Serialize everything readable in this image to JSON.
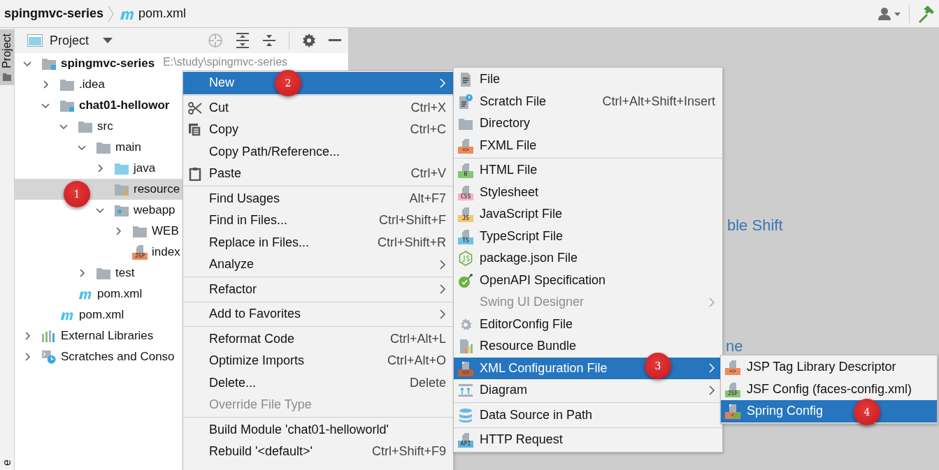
{
  "breadcrumb": {
    "project": "spingmvc-series",
    "file": "pom.xml"
  },
  "side_tabs": [
    {
      "label": "Project",
      "selected": true
    },
    {
      "label": "e",
      "selected": false
    }
  ],
  "project_panel": {
    "title": "Project"
  },
  "tree": [
    {
      "kind": "module",
      "label": "spingmvc-series",
      "path": "E:\\study\\spingmvc-series",
      "expanded": true,
      "selected": false,
      "children": [
        {
          "kind": "folder",
          "label": ".idea",
          "expanded": false,
          "selected": false
        },
        {
          "kind": "module",
          "label": "chat01-hellowor",
          "expanded": true,
          "selected": false,
          "children": [
            {
              "kind": "folder",
              "label": "src",
              "expanded": true,
              "selected": false,
              "children": [
                {
                  "kind": "folder",
                  "label": "main",
                  "expanded": true,
                  "selected": false,
                  "children": [
                    {
                      "kind": "source-folder",
                      "label": "java",
                      "expanded": false,
                      "selected": false
                    },
                    {
                      "kind": "resource-folder",
                      "label": "resource",
                      "selected": true
                    },
                    {
                      "kind": "web-folder",
                      "label": "webapp",
                      "expanded": true,
                      "selected": false,
                      "children": [
                        {
                          "kind": "folder",
                          "label": "WEB",
                          "expanded": false,
                          "selected": false
                        },
                        {
                          "kind": "jsp-file",
                          "badge": "JSP",
                          "label": "index",
                          "selected": false
                        }
                      ]
                    }
                  ]
                },
                {
                  "kind": "folder",
                  "label": "test",
                  "expanded": false,
                  "selected": false
                }
              ]
            },
            {
              "kind": "maven-file",
              "label": "pom.xml",
              "selected": false
            }
          ]
        },
        {
          "kind": "maven-file",
          "label": "pom.xml",
          "selected": false
        }
      ]
    },
    {
      "kind": "libraries",
      "label": "External Libraries",
      "expanded": false,
      "selected": false
    },
    {
      "kind": "scratches",
      "label": "Scratches and Conso",
      "expanded": false,
      "selected": false
    }
  ],
  "editor_hints": [
    "ble Shift",
    "ne"
  ],
  "context_menu": [
    {
      "kind": "none",
      "label": "New",
      "has_submenu": true,
      "selected": true,
      "disabled": false
    },
    {
      "kind": "separator"
    },
    {
      "kind": "cut",
      "label": "Cut",
      "shortcut": "Ctrl+X",
      "has_submenu": false,
      "selected": false,
      "disabled": false
    },
    {
      "kind": "copy",
      "label": "Copy",
      "shortcut": "Ctrl+C",
      "has_submenu": false,
      "selected": false,
      "disabled": false
    },
    {
      "kind": "none",
      "label": "Copy Path/Reference...",
      "has_submenu": false,
      "selected": false,
      "disabled": false
    },
    {
      "kind": "paste",
      "label": "Paste",
      "shortcut": "Ctrl+V",
      "has_submenu": false,
      "selected": false,
      "disabled": false
    },
    {
      "kind": "separator"
    },
    {
      "kind": "none",
      "label": "Find Usages",
      "shortcut": "Alt+F7",
      "has_submenu": false,
      "selected": false,
      "disabled": false
    },
    {
      "kind": "none",
      "label": "Find in Files...",
      "shortcut": "Ctrl+Shift+F",
      "has_submenu": false,
      "selected": false,
      "disabled": false
    },
    {
      "kind": "none",
      "label": "Replace in Files...",
      "shortcut": "Ctrl+Shift+R",
      "has_submenu": false,
      "selected": false,
      "disabled": false
    },
    {
      "kind": "none",
      "label": "Analyze",
      "has_submenu": true,
      "selected": false,
      "disabled": false
    },
    {
      "kind": "separator"
    },
    {
      "kind": "none",
      "label": "Refactor",
      "has_submenu": true,
      "selected": false,
      "disabled": false
    },
    {
      "kind": "separator"
    },
    {
      "kind": "none",
      "label": "Add to Favorites",
      "has_submenu": true,
      "selected": false,
      "disabled": false
    },
    {
      "kind": "separator"
    },
    {
      "kind": "none",
      "label": "Reformat Code",
      "shortcut": "Ctrl+Alt+L",
      "has_submenu": false,
      "selected": false,
      "disabled": false
    },
    {
      "kind": "none",
      "label": "Optimize Imports",
      "shortcut": "Ctrl+Alt+O",
      "has_submenu": false,
      "selected": false,
      "disabled": false
    },
    {
      "kind": "none",
      "label": "Delete...",
      "shortcut": "Delete",
      "has_submenu": false,
      "selected": false,
      "disabled": false
    },
    {
      "kind": "none",
      "label": "Override File Type",
      "has_submenu": false,
      "selected": false,
      "disabled": true
    },
    {
      "kind": "separator"
    },
    {
      "kind": "none",
      "label": "Build Module 'chat01-helloworld'",
      "has_submenu": false,
      "selected": false,
      "disabled": false
    },
    {
      "kind": "none",
      "label": "Rebuild '<default>'",
      "shortcut": "Ctrl+Shift+F9",
      "has_submenu": false,
      "selected": false,
      "disabled": false
    }
  ],
  "new_submenu": [
    {
      "kind": "file",
      "label": "File",
      "has_submenu": false,
      "selected": false,
      "disabled": false
    },
    {
      "kind": "scratch",
      "label": "Scratch File",
      "shortcut": "Ctrl+Alt+Shift+Insert",
      "has_submenu": false,
      "selected": false,
      "disabled": false
    },
    {
      "kind": "folder",
      "label": "Directory",
      "has_submenu": false,
      "selected": false,
      "disabled": false
    },
    {
      "kind": "badge-file",
      "badge": "<>",
      "color": "#ef8a5b",
      "label": "FXML File",
      "has_submenu": false,
      "selected": false,
      "disabled": false
    },
    {
      "kind": "separator"
    },
    {
      "kind": "badge-file",
      "badge": "H",
      "color": "#86c46f",
      "label": "HTML File",
      "has_submenu": false,
      "selected": false,
      "disabled": false
    },
    {
      "kind": "badge-file",
      "badge": "CSS",
      "color": "#f4b3c2",
      "label": "Stylesheet",
      "has_submenu": false,
      "selected": false,
      "disabled": false
    },
    {
      "kind": "badge-file",
      "badge": "JS",
      "color": "#f3c66f",
      "label": "JavaScript File",
      "has_submenu": false,
      "selected": false,
      "disabled": false
    },
    {
      "kind": "badge-file",
      "badge": "TS",
      "color": "#6fc3e3",
      "label": "TypeScript File",
      "has_submenu": false,
      "selected": false,
      "disabled": false
    },
    {
      "kind": "node",
      "label": "package.json File",
      "has_submenu": false,
      "selected": false,
      "disabled": false
    },
    {
      "kind": "openapi",
      "label": "OpenAPI Specification",
      "has_submenu": false,
      "selected": false,
      "disabled": false
    },
    {
      "kind": "none",
      "label": "Swing UI Designer",
      "has_submenu": true,
      "selected": false,
      "disabled": true
    },
    {
      "kind": "gear",
      "label": "EditorConfig File",
      "has_submenu": false,
      "selected": false,
      "disabled": false
    },
    {
      "kind": "bundle",
      "label": "Resource Bundle",
      "has_submenu": false,
      "selected": false,
      "disabled": false
    },
    {
      "kind": "badge-file",
      "badge": "<>",
      "color": "#b8623f",
      "label": "XML Configuration File",
      "has_submenu": true,
      "selected": true,
      "disabled": false
    },
    {
      "kind": "diagram",
      "label": "Diagram",
      "has_submenu": true,
      "selected": false,
      "disabled": false
    },
    {
      "kind": "separator"
    },
    {
      "kind": "database",
      "label": "Data Source in Path",
      "has_submenu": false,
      "selected": false,
      "disabled": false
    },
    {
      "kind": "separator"
    },
    {
      "kind": "badge-file",
      "badge": "API",
      "color": "#62b6e0",
      "label": "HTTP Request",
      "has_submenu": false,
      "selected": false,
      "disabled": false
    }
  ],
  "xml_submenu": [
    {
      "kind": "badge-file",
      "badge": "<>",
      "color": "#ef8a5b",
      "label": "JSP Tag Library Descriptor",
      "has_submenu": false,
      "selected": false,
      "disabled": false
    },
    {
      "kind": "badge-file",
      "badge": "JSF",
      "color": "#86c46f",
      "label": "JSF Config (faces-config.xml)",
      "has_submenu": false,
      "selected": false,
      "disabled": false
    },
    {
      "kind": "spring-file",
      "badge": "<",
      "color": "#d9835b",
      "label": "Spring Config",
      "has_submenu": false,
      "selected": true,
      "disabled": false
    }
  ],
  "markers": [
    "1",
    "2",
    "3",
    "4"
  ]
}
